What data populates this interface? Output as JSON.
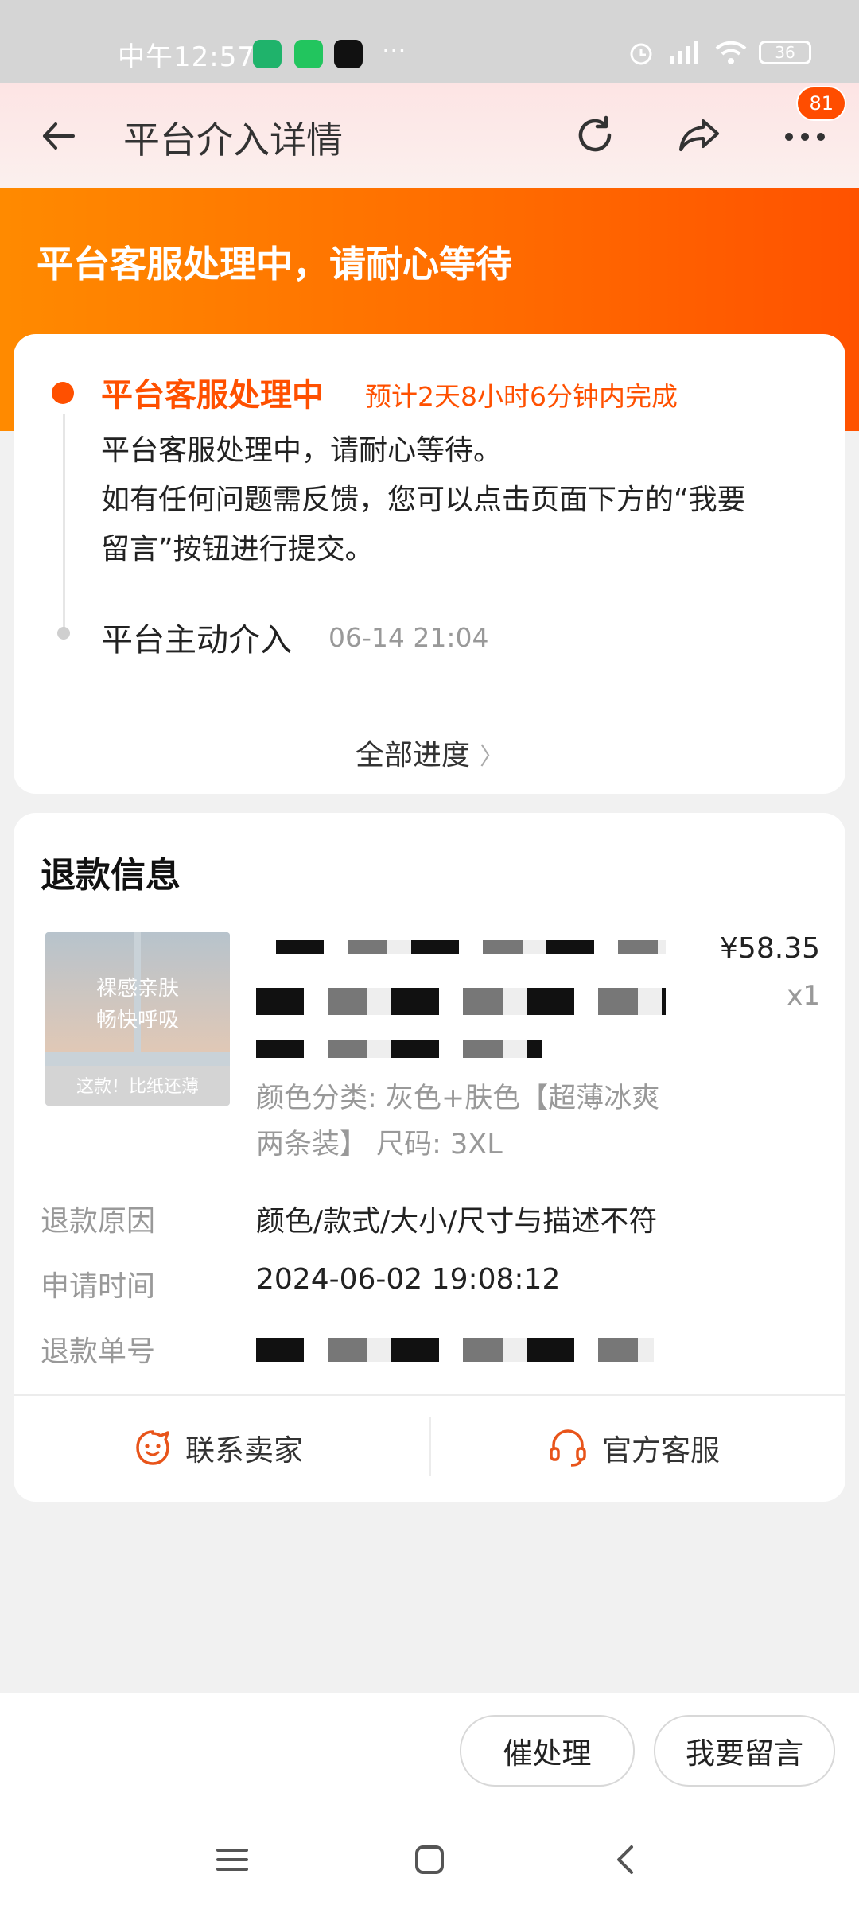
{
  "status_bar": {
    "time": "中午12:57",
    "dots": "···",
    "battery": "36"
  },
  "header": {
    "title": "平台介入详情",
    "badge": "81"
  },
  "banner": {
    "title": "平台客服处理中，请耐心等待"
  },
  "progress": {
    "current_status": "平台客服处理中",
    "eta": "预计2天8小时6分钟内完成",
    "desc_line1": "平台客服处理中，请耐心等待。",
    "desc_line2": "如有任何问题需反馈，您可以点击页面下方的“我要",
    "desc_line3": "留言”按钮进行提交。",
    "step2_label": "平台主动介入",
    "step2_time": "06-14 21:04",
    "all_progress": "全部进度"
  },
  "refund": {
    "section_title": "退款信息",
    "product_image_text1": "裸感亲肤",
    "product_image_text2": "畅快呼吸",
    "product_image_banner": "这款！比纸还薄",
    "price": "¥58.35",
    "qty": "x1",
    "spec": "颜色分类: 灰色+肤色【超薄冰爽两条装】 尺码: 3XL",
    "reason_label": "退款原因",
    "reason_value": "颜色/款式/大小/尺寸与描述不符",
    "time_label": "申请时间",
    "time_value": "2024-06-02 19:08:12",
    "order_label": "退款单号",
    "contact_seller": "联系卖家",
    "official_service": "官方客服"
  },
  "bottom": {
    "urge_button": "催处理",
    "message_button": "我要留言"
  },
  "colors": {
    "accent": "#ff5000",
    "banner_start": "#ff8a00",
    "banner_end": "#ff5200"
  }
}
